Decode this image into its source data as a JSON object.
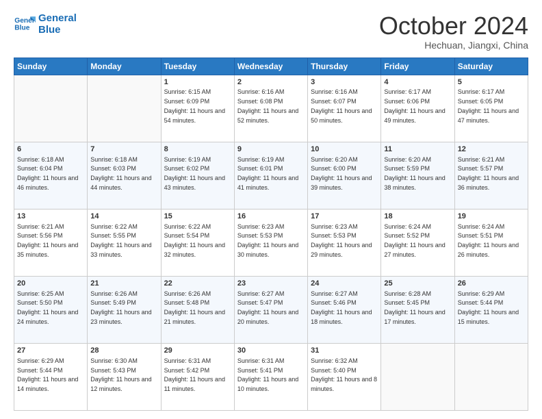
{
  "logo": {
    "line1": "General",
    "line2": "Blue"
  },
  "title": "October 2024",
  "subtitle": "Hechuan, Jiangxi, China",
  "weekdays": [
    "Sunday",
    "Monday",
    "Tuesday",
    "Wednesday",
    "Thursday",
    "Friday",
    "Saturday"
  ],
  "weeks": [
    [
      {
        "day": null
      },
      {
        "day": null
      },
      {
        "day": 1,
        "sunrise": "6:15 AM",
        "sunset": "6:09 PM",
        "daylight": "11 hours and 54 minutes."
      },
      {
        "day": 2,
        "sunrise": "6:16 AM",
        "sunset": "6:08 PM",
        "daylight": "11 hours and 52 minutes."
      },
      {
        "day": 3,
        "sunrise": "6:16 AM",
        "sunset": "6:07 PM",
        "daylight": "11 hours and 50 minutes."
      },
      {
        "day": 4,
        "sunrise": "6:17 AM",
        "sunset": "6:06 PM",
        "daylight": "11 hours and 49 minutes."
      },
      {
        "day": 5,
        "sunrise": "6:17 AM",
        "sunset": "6:05 PM",
        "daylight": "11 hours and 47 minutes."
      }
    ],
    [
      {
        "day": 6,
        "sunrise": "6:18 AM",
        "sunset": "6:04 PM",
        "daylight": "11 hours and 46 minutes."
      },
      {
        "day": 7,
        "sunrise": "6:18 AM",
        "sunset": "6:03 PM",
        "daylight": "11 hours and 44 minutes."
      },
      {
        "day": 8,
        "sunrise": "6:19 AM",
        "sunset": "6:02 PM",
        "daylight": "11 hours and 43 minutes."
      },
      {
        "day": 9,
        "sunrise": "6:19 AM",
        "sunset": "6:01 PM",
        "daylight": "11 hours and 41 minutes."
      },
      {
        "day": 10,
        "sunrise": "6:20 AM",
        "sunset": "6:00 PM",
        "daylight": "11 hours and 39 minutes."
      },
      {
        "day": 11,
        "sunrise": "6:20 AM",
        "sunset": "5:59 PM",
        "daylight": "11 hours and 38 minutes."
      },
      {
        "day": 12,
        "sunrise": "6:21 AM",
        "sunset": "5:57 PM",
        "daylight": "11 hours and 36 minutes."
      }
    ],
    [
      {
        "day": 13,
        "sunrise": "6:21 AM",
        "sunset": "5:56 PM",
        "daylight": "11 hours and 35 minutes."
      },
      {
        "day": 14,
        "sunrise": "6:22 AM",
        "sunset": "5:55 PM",
        "daylight": "11 hours and 33 minutes."
      },
      {
        "day": 15,
        "sunrise": "6:22 AM",
        "sunset": "5:54 PM",
        "daylight": "11 hours and 32 minutes."
      },
      {
        "day": 16,
        "sunrise": "6:23 AM",
        "sunset": "5:53 PM",
        "daylight": "11 hours and 30 minutes."
      },
      {
        "day": 17,
        "sunrise": "6:23 AM",
        "sunset": "5:53 PM",
        "daylight": "11 hours and 29 minutes."
      },
      {
        "day": 18,
        "sunrise": "6:24 AM",
        "sunset": "5:52 PM",
        "daylight": "11 hours and 27 minutes."
      },
      {
        "day": 19,
        "sunrise": "6:24 AM",
        "sunset": "5:51 PM",
        "daylight": "11 hours and 26 minutes."
      }
    ],
    [
      {
        "day": 20,
        "sunrise": "6:25 AM",
        "sunset": "5:50 PM",
        "daylight": "11 hours and 24 minutes."
      },
      {
        "day": 21,
        "sunrise": "6:26 AM",
        "sunset": "5:49 PM",
        "daylight": "11 hours and 23 minutes."
      },
      {
        "day": 22,
        "sunrise": "6:26 AM",
        "sunset": "5:48 PM",
        "daylight": "11 hours and 21 minutes."
      },
      {
        "day": 23,
        "sunrise": "6:27 AM",
        "sunset": "5:47 PM",
        "daylight": "11 hours and 20 minutes."
      },
      {
        "day": 24,
        "sunrise": "6:27 AM",
        "sunset": "5:46 PM",
        "daylight": "11 hours and 18 minutes."
      },
      {
        "day": 25,
        "sunrise": "6:28 AM",
        "sunset": "5:45 PM",
        "daylight": "11 hours and 17 minutes."
      },
      {
        "day": 26,
        "sunrise": "6:29 AM",
        "sunset": "5:44 PM",
        "daylight": "11 hours and 15 minutes."
      }
    ],
    [
      {
        "day": 27,
        "sunrise": "6:29 AM",
        "sunset": "5:44 PM",
        "daylight": "11 hours and 14 minutes."
      },
      {
        "day": 28,
        "sunrise": "6:30 AM",
        "sunset": "5:43 PM",
        "daylight": "11 hours and 12 minutes."
      },
      {
        "day": 29,
        "sunrise": "6:31 AM",
        "sunset": "5:42 PM",
        "daylight": "11 hours and 11 minutes."
      },
      {
        "day": 30,
        "sunrise": "6:31 AM",
        "sunset": "5:41 PM",
        "daylight": "11 hours and 10 minutes."
      },
      {
        "day": 31,
        "sunrise": "6:32 AM",
        "sunset": "5:40 PM",
        "daylight": "11 hours and 8 minutes."
      },
      {
        "day": null
      },
      {
        "day": null
      }
    ]
  ]
}
